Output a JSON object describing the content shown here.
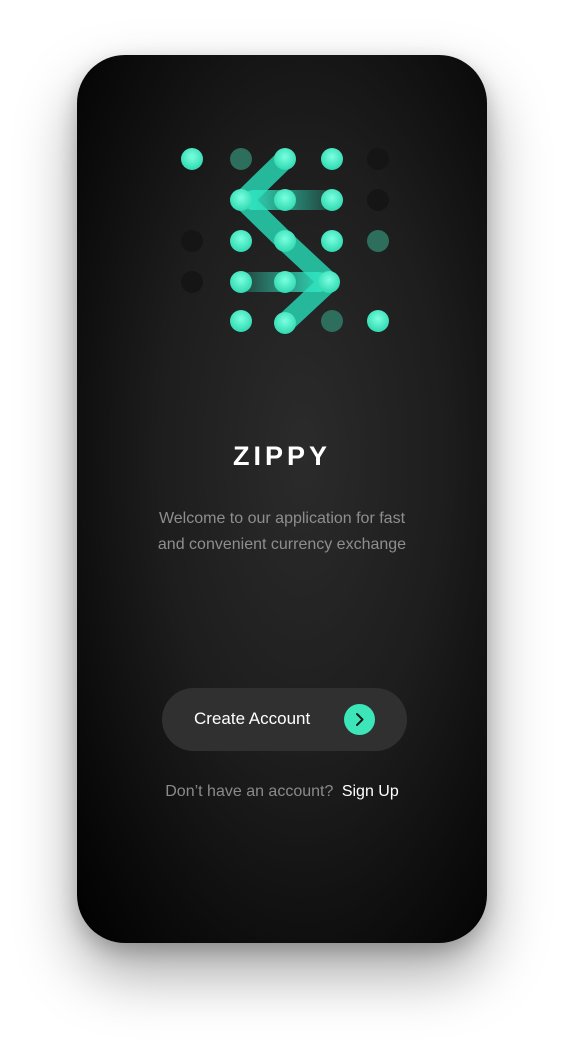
{
  "app": {
    "brand_name": "ZIPPY",
    "tagline": "Welcome to our application for fast and convenient currency exchange"
  },
  "actions": {
    "create_account_label": "Create Account",
    "signup_prompt": "Don’t have an account?",
    "signup_link": "Sign Up"
  },
  "colors": {
    "accent": "#3de6b8",
    "accent_dim": "#2e6e5c",
    "background": "#1d1d1d",
    "button_bg": "#303030"
  },
  "icons": {
    "logo": "dot-grid-exchange-arrows-logo",
    "cta_arrow": "chevron-right-icon"
  }
}
